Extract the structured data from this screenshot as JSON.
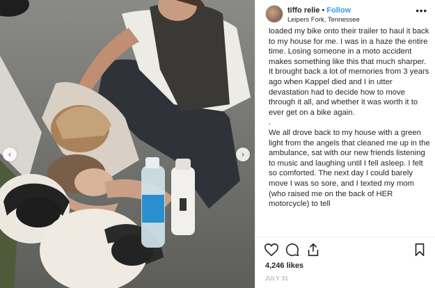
{
  "post": {
    "username": "tiffo relie",
    "separator": "•",
    "follow_label": "Follow",
    "location": "Leipers Fork, Tennessee",
    "more_label": "•••",
    "caption_part1": "loaded my bike onto their trailer to haul it back to my house for me. I was in a haze the entire time. Losing someone in a moto accident makes something like this that much sharper. It brought back a lot of memories from 3 years ago when Kappel died and I in utter devastation had to decide how to move through it all, and whether it was worth it to ever get on a bike again.",
    "caption_dot": ".",
    "caption_part2": "We all drove back to my house with a green light from the angels that cleaned me up in the ambulance, sat with our new friends listening to music and laughing until I fell asleep. I felt so comforted. The next day I could barely move I was so sore, and I texted my mom (who raised me on the back of HER motorcycle) to tell",
    "likes": "4,246 likes",
    "date": "JULY 31"
  },
  "icons": {
    "prev": "chevron-left-icon",
    "next": "chevron-right-icon",
    "like": "heart-icon",
    "comment": "comment-icon",
    "share": "share-icon",
    "save": "bookmark-icon"
  },
  "colors": {
    "accent": "#3897f0",
    "text": "#262626",
    "muted": "#999999"
  }
}
